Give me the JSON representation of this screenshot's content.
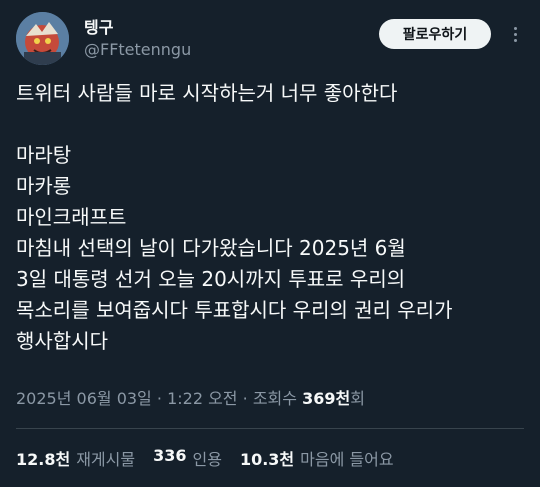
{
  "author": {
    "display_name": "텡구",
    "handle": "@FFtetenngu"
  },
  "actions": {
    "follow_label": "팔로우하기",
    "more_icon": "more-dots-icon"
  },
  "tweet": {
    "lines": [
      "트위터 사람들 마로 시작하는거 너무 좋아한다",
      "",
      "마라탕",
      "마카롱",
      "마인크래프트",
      "마침내 선택의 날이 다가왔습니다 2025년 6월",
      "3일 대통령 선거 오늘 20시까지 투표로 우리의",
      "목소리를 보여줍시다 투표합시다 우리의 권리 우리가",
      "행사합시다"
    ]
  },
  "meta": {
    "date": "2025년 06월 03일",
    "separator": "·",
    "time": "1:22 오전",
    "views_prefix": "조회수",
    "views_count": "369천",
    "views_suffix": "회"
  },
  "stats": [
    {
      "count": "12.8천",
      "label": "재게시물"
    },
    {
      "count": "336",
      "label": "인용"
    },
    {
      "count": "10.3천",
      "label": "마음에 들어요"
    }
  ],
  "colors": {
    "background": "#15202b",
    "text": "#f7f9f9",
    "secondary": "#8b98a5",
    "button_bg": "#eff3f4"
  }
}
